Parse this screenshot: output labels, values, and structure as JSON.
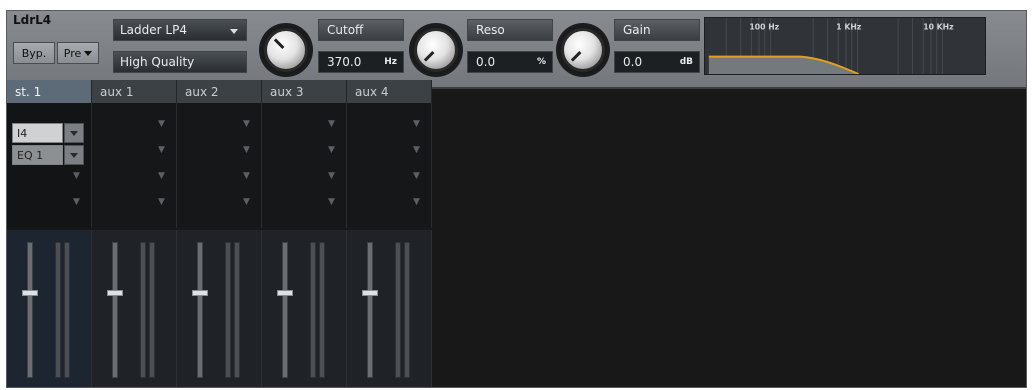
{
  "module": {
    "title": "LdrL4",
    "bypass_label": "Byp.",
    "pre_label": "Pre",
    "filter_type": "Ladder LP4",
    "quality": "High Quality"
  },
  "controls": {
    "cutoff": {
      "label": "Cutoff",
      "value": "370.0",
      "unit": "Hz"
    },
    "reso": {
      "label": "Reso",
      "value": "0.0",
      "unit": "%"
    },
    "gain": {
      "label": "Gain",
      "value": "0.0",
      "unit": "dB"
    }
  },
  "graph": {
    "freq_labels": [
      "100 Hz",
      "1 KHz",
      "10 KHz"
    ],
    "curve_color": "#e0a21a"
  },
  "mixer": {
    "tabs": [
      "st. 1",
      "aux 1",
      "aux 2",
      "aux 3",
      "aux 4"
    ],
    "active_tab": "st. 1",
    "slots": [
      "I4",
      "EQ 1"
    ]
  },
  "colors": {
    "panel": "#7c8084",
    "active_tab": "#5d6a77",
    "curve": "#e0a21a"
  }
}
